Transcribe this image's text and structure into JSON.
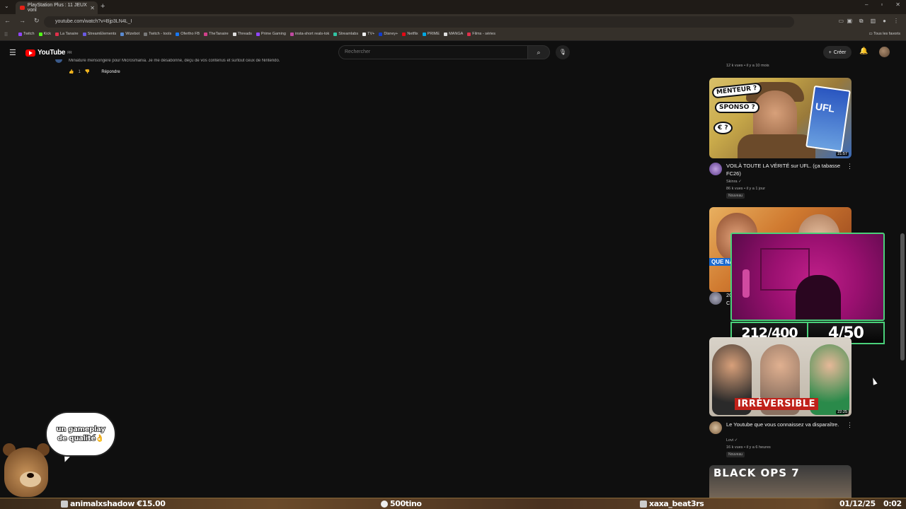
{
  "browser": {
    "tab_title": "PlayStation Plus : 11 JEUX vonl",
    "url": "youtube.com/watch?v=Bjp3LN4L_I",
    "bookmarks": [
      "Twitch",
      "Kick",
      "La Tanaire",
      "StreamElements",
      "Wizebot",
      "Twitch - tools",
      "Ofertho FB",
      "TheTanaire",
      "Threads",
      "Prime Gaming",
      "insta-short reals-tok",
      "Streamlabs",
      "TV+",
      "Disney+",
      "Netflix",
      "PRIME",
      "MANGA",
      "Films - séries"
    ],
    "bookmarks_all": "Tous les favoris"
  },
  "youtube": {
    "logo_text": "YouTube",
    "logo_region": "FR",
    "search_placeholder": "Rechercher",
    "create_label": "Créer"
  },
  "comment": {
    "text": "Miniature mensongère pour Microsmania. Je me désabonne, déçu de vos contenus et surtout ceux de Nintendo.",
    "likes": "1",
    "reply_label": "Répondre"
  },
  "videos": [
    {
      "stats": "12 k vues • il y a 10 mois"
    },
    {
      "bubble1": "MENTEUR ?",
      "bubble2": "SPONSO ?",
      "bubble3": "€ ?",
      "box": "UFL",
      "duration": "21:57",
      "title": "VOILÀ TOUTE LA VÉRITÉ sur UFL. (ça tabasse FC26)",
      "channel": "Skinra",
      "stats": "86 k vues • il y a 1 jour",
      "badge": "Nouveau"
    },
    {
      "label": "QUE NAIS",
      "title_frag": "20",
      "title_frag2": "C"
    },
    {
      "overlay": "IRRÉVERSIBLE",
      "duration": "22:25",
      "title": "Le Youtube que vous connaissez va disparaître.",
      "channel": "Lovi",
      "stats": "16 k vues • il y a 6 heures",
      "badge": "Nouveau"
    },
    {
      "thumb_text": "BLACK OPS 7"
    }
  ],
  "stream": {
    "counter_left": "212/400",
    "counter_right": "4/50",
    "bubble_line1": "un gameplay",
    "bubble_line2": "de qualité👌",
    "ticker": {
      "donation": "animalxshadow €15.00",
      "follow": "500tino",
      "sub": "xaxa_beat3rs",
      "date": "01/12/25",
      "time": "0:02"
    }
  }
}
